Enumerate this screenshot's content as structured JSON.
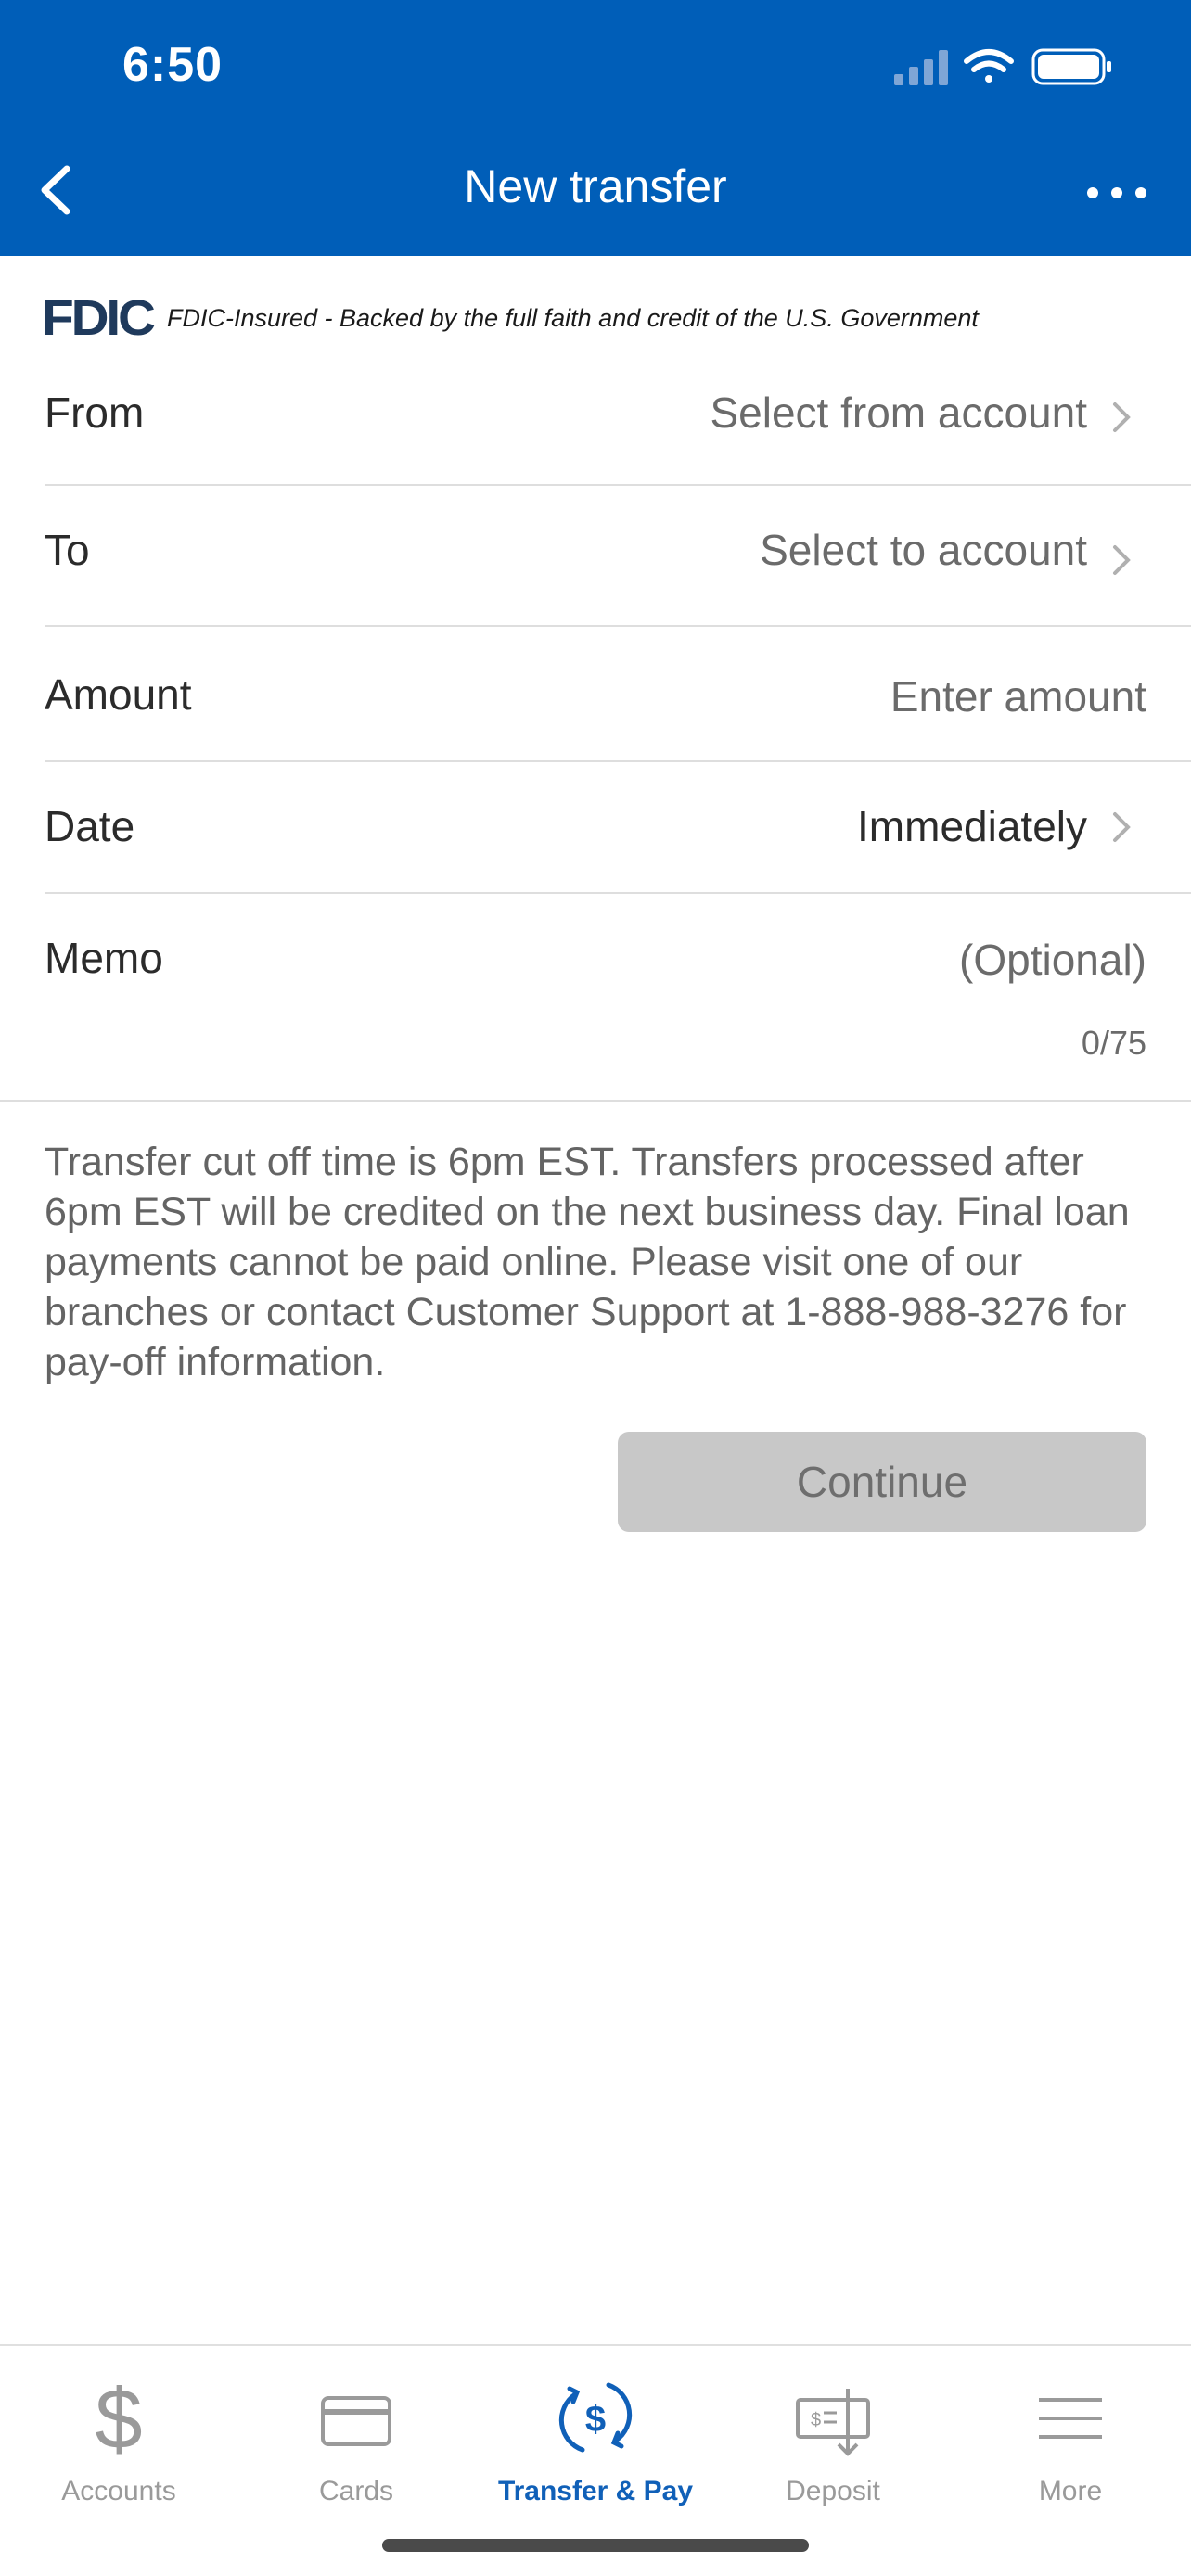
{
  "status_bar": {
    "time": "6:50"
  },
  "nav": {
    "title": "New transfer"
  },
  "fdic": {
    "logo_text": "FDIC",
    "text": "FDIC-Insured - Backed by the full faith and credit of the U.S. Government"
  },
  "form": {
    "from": {
      "label": "From",
      "value": "Select from account"
    },
    "to": {
      "label": "To",
      "value": "Select to account"
    },
    "amount": {
      "label": "Amount",
      "placeholder": "Enter amount"
    },
    "date": {
      "label": "Date",
      "value": "Immediately"
    },
    "memo": {
      "label": "Memo",
      "placeholder": "(Optional)",
      "counter": "0/75"
    }
  },
  "notice": "Transfer cut off time is 6pm EST. Transfers processed after 6pm EST will be credited on the next business day. Final loan payments cannot be paid online. Please visit one of our branches or contact Customer Support at 1-888-988-3276 for pay-off information.",
  "continue_label": "Continue",
  "tabs": [
    {
      "label": "Accounts",
      "icon": "dollar-icon",
      "active": false
    },
    {
      "label": "Cards",
      "icon": "card-icon",
      "active": false
    },
    {
      "label": "Transfer & Pay",
      "icon": "transfer-pay-icon",
      "active": true
    },
    {
      "label": "Deposit",
      "icon": "check-deposit-icon",
      "active": false
    },
    {
      "label": "More",
      "icon": "menu-icon",
      "active": false
    }
  ],
  "colors": {
    "brand": "#005eb8",
    "active_tab": "#1060b8",
    "disabled_button": "#c8c8c8"
  }
}
